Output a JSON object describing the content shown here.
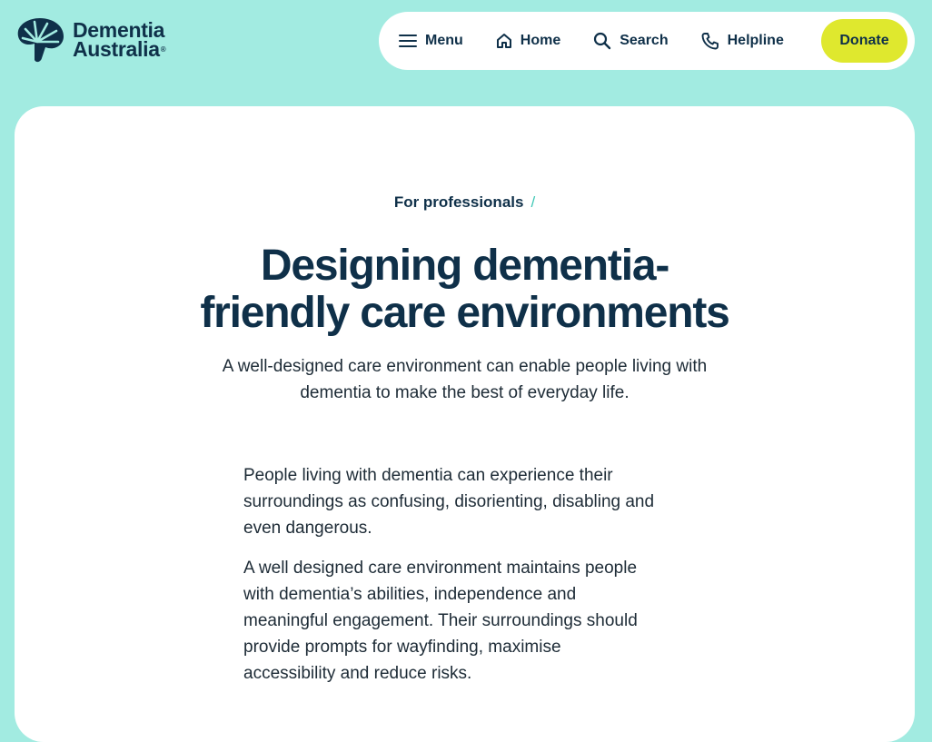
{
  "logo": {
    "line1": "Dementia",
    "line2": "Australia",
    "registered": "®",
    "icon": "brain-tree-logo-icon"
  },
  "nav": {
    "items": [
      {
        "label": "Menu",
        "icon": "hamburger-menu-icon"
      },
      {
        "label": "Home",
        "icon": "home-icon"
      },
      {
        "label": "Search",
        "icon": "search-icon"
      },
      {
        "label": "Helpline",
        "icon": "phone-icon"
      }
    ],
    "donate_label": "Donate"
  },
  "breadcrumb": {
    "label": "For professionals",
    "separator": "/"
  },
  "page": {
    "title_lines": [
      "Designing dementia-",
      "friendly care environments"
    ],
    "subtitle_lines": [
      "A well-designed care environment can enable people living with",
      "dementia to make the best of everyday life."
    ],
    "paragraphs": [
      [
        "People living with dementia can experience their",
        "surroundings as confusing, disorienting, disabling and",
        "even dangerous."
      ],
      [
        "A well designed care environment maintains people",
        "with dementia’s abilities, independence and",
        "meaningful engagement. Their surroundings should",
        "provide prompts for wayfinding, maximise",
        "accessibility and reduce risks."
      ]
    ]
  },
  "colors": {
    "background": "#a2ebe1",
    "navy": "#0f3049",
    "donate": "#dfe82e",
    "accent": "#3fc7b5"
  }
}
